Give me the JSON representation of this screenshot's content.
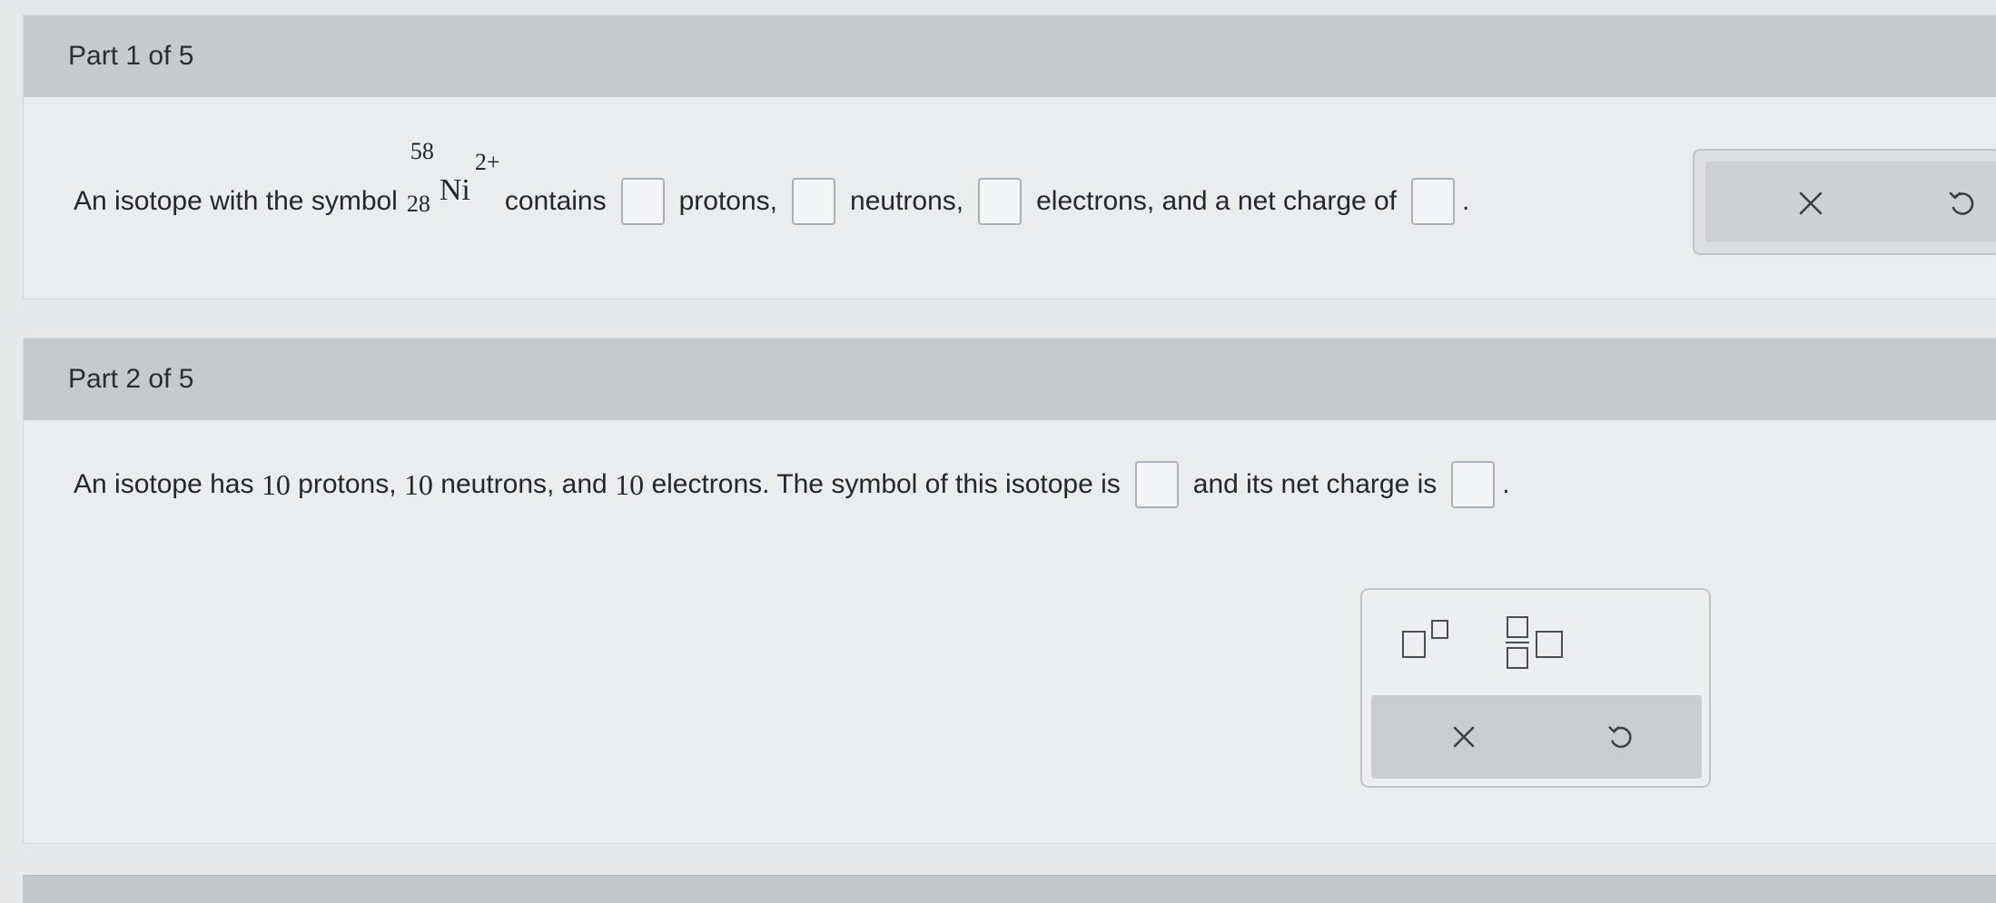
{
  "parts": [
    {
      "title": "Part 1 of 5",
      "question": {
        "intro": "An isotope with the symbol",
        "isotope": {
          "mass_number": "58",
          "atomic_number": "28",
          "element": "Ni",
          "charge": "2+"
        },
        "contains": "contains",
        "protons": "protons,",
        "neutrons": "neutrons,",
        "electrons": "electrons, and a net charge of",
        "end": "."
      },
      "actions": {
        "clear_icon": "x-icon",
        "undo_icon": "undo-icon"
      }
    },
    {
      "title": "Part 2 of 5",
      "question": {
        "t1": "An isotope has",
        "protons_count": "10",
        "t2": "protons,",
        "neutrons_count": "10",
        "t3": "neutrons, and",
        "electrons_count": "10",
        "t4": "electrons. The symbol of this isotope is",
        "t5": "and its net charge is",
        "end": "."
      },
      "tools": {
        "superscript_icon": "superscript-template-icon",
        "isotope_icon": "isotope-notation-template-icon",
        "clear_icon": "x-icon",
        "undo_icon": "undo-icon"
      }
    }
  ],
  "colors": {
    "page_background": "#e7e8ea",
    "part_header": "#c6cacd",
    "panel_background": "#ebecee",
    "answer_box_border": "#a9b0b6",
    "icon": "#3a3f44"
  }
}
